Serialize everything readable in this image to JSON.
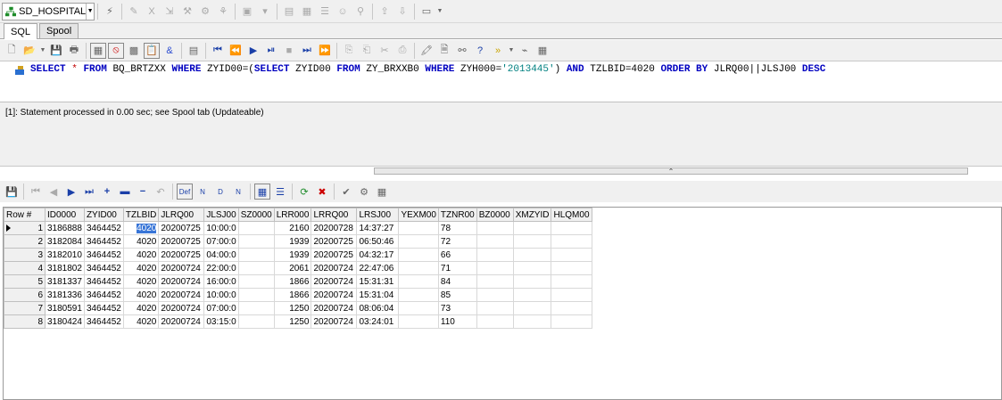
{
  "connection": {
    "name": "SD_HOSPITAL"
  },
  "tabs": [
    {
      "label": "SQL"
    },
    {
      "label": "Spool"
    }
  ],
  "editor": {
    "tokens": [
      {
        "t": "SELECT",
        "c": "kw"
      },
      {
        "t": " "
      },
      {
        "t": "*",
        "c": "op"
      },
      {
        "t": " "
      },
      {
        "t": "FROM",
        "c": "kw"
      },
      {
        "t": " BQ_BRTZXX "
      },
      {
        "t": "WHERE",
        "c": "kw"
      },
      {
        "t": " ZYID00=("
      },
      {
        "t": "SELECT",
        "c": "kw"
      },
      {
        "t": " ZYID00 "
      },
      {
        "t": "FROM",
        "c": "kw"
      },
      {
        "t": " ZY_BRXXB0 "
      },
      {
        "t": "WHERE",
        "c": "kw"
      },
      {
        "t": " ZYH000="
      },
      {
        "t": "'2013445'",
        "c": "str"
      },
      {
        "t": ") "
      },
      {
        "t": "AND",
        "c": "kw"
      },
      {
        "t": " TZLBID=4020 "
      },
      {
        "t": "ORDER BY",
        "c": "kw"
      },
      {
        "t": " JLRQ00||JLSJ00 "
      },
      {
        "t": "DESC",
        "c": "kw"
      }
    ]
  },
  "output": {
    "message": "[1]: Statement processed in 0.00 sec; see Spool tab (Updateable)"
  },
  "grid": {
    "columns": [
      "Row #",
      "ID0000",
      "ZYID00",
      "TZLBID",
      "JLRQ00",
      "JLSJ00",
      "SZ0000",
      "LRR000",
      "LRRQ00",
      "LRSJ00",
      "YEXM00",
      "TZNR00",
      "BZ0000",
      "XMZYID",
      "HLQM00"
    ],
    "rows": [
      [
        "1",
        "3186888",
        "3464452",
        "4020",
        "20200725",
        "10:00:0",
        "",
        "2160",
        "20200728",
        "14:37:27",
        "",
        "78",
        "",
        "",
        ""
      ],
      [
        "2",
        "3182084",
        "3464452",
        "4020",
        "20200725",
        "07:00:0",
        "",
        "1939",
        "20200725",
        "06:50:46",
        "",
        "72",
        "",
        "",
        ""
      ],
      [
        "3",
        "3182010",
        "3464452",
        "4020",
        "20200725",
        "04:00:0",
        "",
        "1939",
        "20200725",
        "04:32:17",
        "",
        "66",
        "",
        "",
        ""
      ],
      [
        "4",
        "3181802",
        "3464452",
        "4020",
        "20200724",
        "22:00:0",
        "",
        "2061",
        "20200724",
        "22:47:06",
        "",
        "71",
        "",
        "",
        ""
      ],
      [
        "5",
        "3181337",
        "3464452",
        "4020",
        "20200724",
        "16:00:0",
        "",
        "1866",
        "20200724",
        "15:31:31",
        "",
        "84",
        "",
        "",
        ""
      ],
      [
        "6",
        "3181336",
        "3464452",
        "4020",
        "20200724",
        "10:00:0",
        "",
        "1866",
        "20200724",
        "15:31:04",
        "",
        "85",
        "",
        "",
        ""
      ],
      [
        "7",
        "3180591",
        "3464452",
        "4020",
        "20200724",
        "07:00:0",
        "",
        "1250",
        "20200724",
        "08:06:04",
        "",
        "73",
        "",
        "",
        ""
      ],
      [
        "8",
        "3180424",
        "3464452",
        "4020",
        "20200724",
        "03:15:0",
        "",
        "1250",
        "20200724",
        "03:24:01",
        "",
        "110",
        "",
        "",
        ""
      ]
    ]
  },
  "colors": {
    "selection": "#3875d7",
    "keyword": "#0000c0",
    "string": "#008080"
  }
}
